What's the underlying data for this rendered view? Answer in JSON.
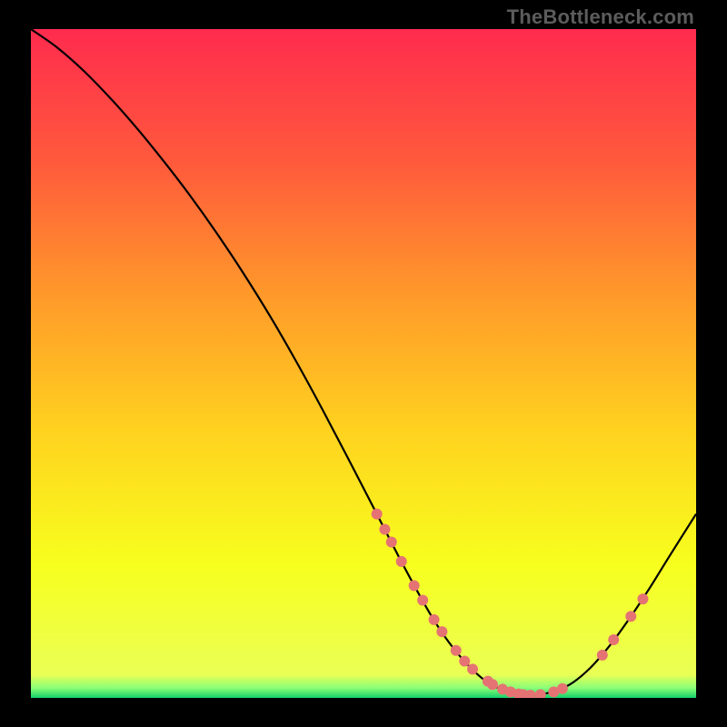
{
  "watermark": "TheBottleneck.com",
  "chart_data": {
    "type": "line",
    "title": "",
    "xlabel": "",
    "ylabel": "",
    "xlim": [
      0,
      100
    ],
    "ylim": [
      0,
      100
    ],
    "grid": false,
    "legend": false,
    "gradient_stops": [
      {
        "offset": 0.0,
        "color": "#ff2b4e"
      },
      {
        "offset": 0.2,
        "color": "#ff5a3c"
      },
      {
        "offset": 0.4,
        "color": "#ff9a2a"
      },
      {
        "offset": 0.6,
        "color": "#ffd21f"
      },
      {
        "offset": 0.8,
        "color": "#f7ff1e"
      },
      {
        "offset": 0.965,
        "color": "#eaff55"
      },
      {
        "offset": 0.985,
        "color": "#8bff77"
      },
      {
        "offset": 1.0,
        "color": "#12d06a"
      }
    ],
    "curve": {
      "x": [
        0,
        4,
        8,
        12,
        16,
        20,
        24,
        28,
        32,
        36,
        40,
        44,
        48,
        52,
        56,
        60,
        63,
        66,
        69,
        72,
        75,
        78,
        81,
        84,
        87,
        90,
        93,
        96,
        100
      ],
      "y": [
        100,
        97.2,
        93.7,
        89.6,
        85.1,
        80.2,
        75.0,
        69.4,
        63.4,
        57.0,
        50.1,
        42.8,
        35.2,
        27.5,
        19.8,
        12.6,
        8.1,
        4.6,
        2.1,
        0.9,
        0.4,
        0.8,
        2.0,
        4.4,
        7.8,
        11.9,
        16.4,
        21.2,
        27.5
      ]
    },
    "dots": {
      "color": "#e57373",
      "radius_px": 6,
      "points": [
        {
          "x": 52.0,
          "y": 27.5
        },
        {
          "x": 53.2,
          "y": 25.2
        },
        {
          "x": 54.2,
          "y": 23.3
        },
        {
          "x": 55.7,
          "y": 20.4
        },
        {
          "x": 57.6,
          "y": 16.8
        },
        {
          "x": 58.9,
          "y": 14.6
        },
        {
          "x": 60.6,
          "y": 11.7
        },
        {
          "x": 61.8,
          "y": 9.9
        },
        {
          "x": 63.9,
          "y": 7.1
        },
        {
          "x": 65.2,
          "y": 5.5
        },
        {
          "x": 66.4,
          "y": 4.3
        },
        {
          "x": 68.7,
          "y": 2.5
        },
        {
          "x": 69.4,
          "y": 2.0
        },
        {
          "x": 70.9,
          "y": 1.3
        },
        {
          "x": 72.1,
          "y": 0.9
        },
        {
          "x": 73.3,
          "y": 0.6
        },
        {
          "x": 74.0,
          "y": 0.5
        },
        {
          "x": 75.1,
          "y": 0.4
        },
        {
          "x": 76.6,
          "y": 0.5
        },
        {
          "x": 78.6,
          "y": 0.9
        },
        {
          "x": 79.9,
          "y": 1.4
        },
        {
          "x": 85.9,
          "y": 6.4
        },
        {
          "x": 87.6,
          "y": 8.7
        },
        {
          "x": 90.2,
          "y": 12.2
        },
        {
          "x": 92.0,
          "y": 14.8
        }
      ]
    }
  }
}
